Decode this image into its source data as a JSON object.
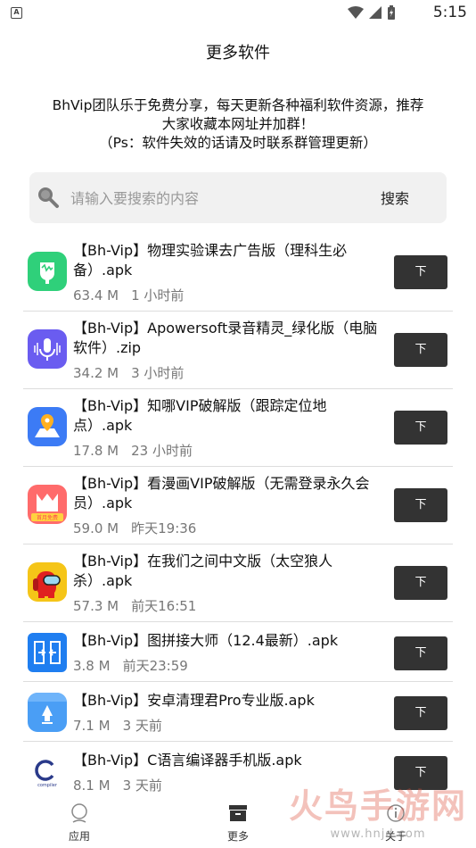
{
  "status_bar": {
    "time": "5:15",
    "notification_icon": "A"
  },
  "header": {
    "title": "更多软件"
  },
  "notice": {
    "line1": "BhVip团队乐于免费分享，每天更新各种福利软件资源，推荐",
    "line2": "大家收藏本网址并加群！",
    "line3": "（Ps：软件失效的话请及时联系群管理更新）"
  },
  "search": {
    "placeholder": "请输入要搜索的内容",
    "button_label": "搜索"
  },
  "apps": [
    {
      "title": "【Bh-Vip】物理实验课去广告版（理科生必备）.apk",
      "size": "63.4 M",
      "time": "1 小时前",
      "download_label": "下",
      "icon_color": "#2fd07a"
    },
    {
      "title": "【Bh-Vip】Apowersoft录音精灵_绿化版（电脑软件）.zip",
      "size": "34.2 M",
      "time": "3 小时前",
      "download_label": "下",
      "icon_color": "#6a5cf0"
    },
    {
      "title": "【Bh-Vip】知哪VIP破解版（跟踪定位地点）.apk",
      "size": "17.8 M",
      "time": "23 小时前",
      "download_label": "下",
      "icon_color": "#3c7bf5"
    },
    {
      "title": "【Bh-Vip】看漫画VIP破解版（无需登录永久会员）.apk",
      "size": "59.0 M",
      "time": "昨天19:36",
      "download_label": "下",
      "icon_color": "#ff6b6b",
      "icon_text": "首月免费"
    },
    {
      "title": "【Bh-Vip】在我们之间中文版（太空狼人杀）.apk",
      "size": "57.3 M",
      "time": "前天16:51",
      "download_label": "下",
      "icon_color": "#f5c518"
    },
    {
      "title": "【Bh-Vip】图拼接大师（12.4最新）.apk",
      "size": "3.8 M",
      "time": "前天23:59",
      "download_label": "下",
      "icon_color": "#1f7ef0"
    },
    {
      "title": "【Bh-Vip】安卓清理君Pro专业版.apk",
      "size": "7.1 M",
      "time": "3 天前",
      "download_label": "下",
      "icon_color": "#4a9ef5"
    },
    {
      "title": "【Bh-Vip】C语言编译器手机版.apk",
      "size": "8.1 M",
      "time": "3 天前",
      "download_label": "下",
      "icon_color": "#ffffff",
      "icon_text": "compiler"
    }
  ],
  "tabs": [
    {
      "label": "应用",
      "icon": "person-icon"
    },
    {
      "label": "更多",
      "icon": "box-icon"
    },
    {
      "label": "关于",
      "icon": "info-icon"
    }
  ],
  "watermark": {
    "text": "火鸟手游网",
    "sub": "www.hnjd.com"
  }
}
